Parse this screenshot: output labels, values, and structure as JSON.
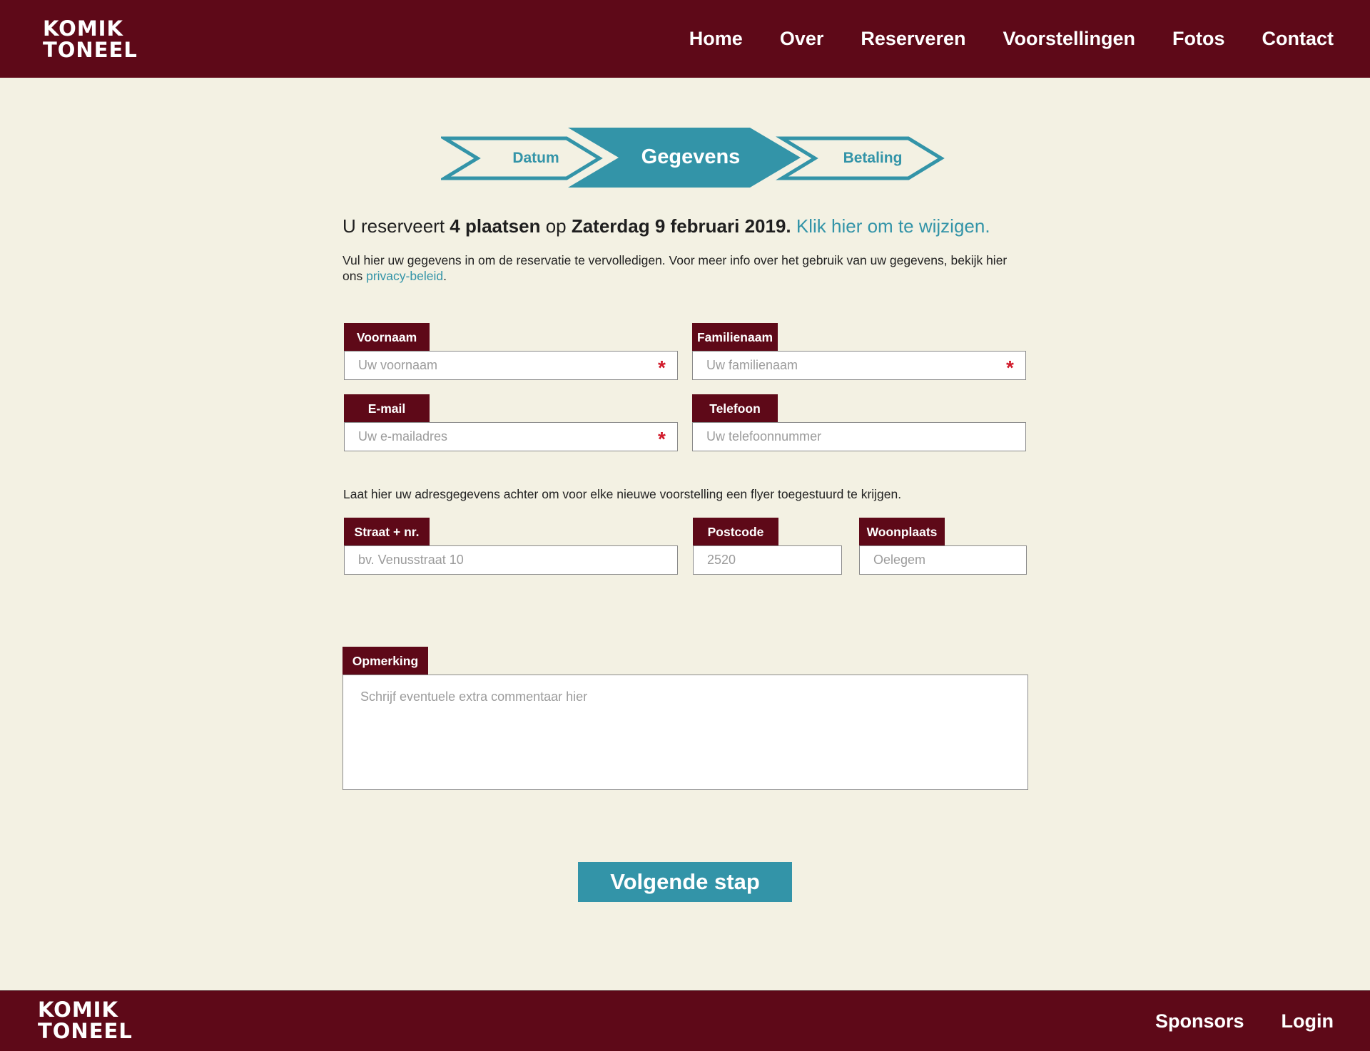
{
  "brand": {
    "logo_line1": "KOMIK",
    "logo_line2": "TONEEL"
  },
  "nav": {
    "items": [
      {
        "label": "Home"
      },
      {
        "label": "Over"
      },
      {
        "label": "Reserveren"
      },
      {
        "label": "Voorstellingen"
      },
      {
        "label": "Fotos"
      },
      {
        "label": "Contact"
      }
    ]
  },
  "stepper": {
    "steps": [
      {
        "label": "Datum",
        "state": "inactive"
      },
      {
        "label": "Gegevens",
        "state": "active"
      },
      {
        "label": "Betaling",
        "state": "inactive"
      }
    ]
  },
  "summary": {
    "prefix": "U reserveert",
    "seats": "4 plaatsen",
    "middle": "op",
    "date": "Zaterdag 9 februari 2019.",
    "change_link": "Klik hier om te wijzigen."
  },
  "info": {
    "text_before": "Vul hier uw gegevens in om de reservatie te vervolledigen. Voor meer info over het gebruik van uw gegevens, bekijk hier ons",
    "privacy_link": "privacy-beleid",
    "text_after": "."
  },
  "fields": {
    "voornaam": {
      "label": "Voornaam",
      "placeholder": "Uw voornaam",
      "required_mark": "*"
    },
    "familienaam": {
      "label": "Familienaam",
      "placeholder": "Uw familienaam",
      "required_mark": "*"
    },
    "email": {
      "label": "E-mail",
      "placeholder": "Uw e-mailadres",
      "required_mark": "*"
    },
    "telefoon": {
      "label": "Telefoon",
      "placeholder": "Uw telefoonnummer"
    },
    "straat": {
      "label": "Straat + nr.",
      "placeholder": "bv. Venusstraat 10"
    },
    "postcode": {
      "label": "Postcode",
      "placeholder": "2520"
    },
    "woonplaats": {
      "label": "Woonplaats",
      "placeholder": "Oelegem"
    }
  },
  "address_info": "Laat hier uw adresgegevens achter om voor elke nieuwe voorstelling een flyer toegestuurd te krijgen.",
  "remark": {
    "label": "Opmerking",
    "placeholder": "Schrijf eventuele extra commentaar hier"
  },
  "next_button": "Volgende stap",
  "footer": {
    "items": [
      {
        "label": "Sponsors"
      },
      {
        "label": "Login"
      }
    ]
  },
  "colors": {
    "header_bg": "#5e0918",
    "page_bg": "#f3f1e3",
    "accent": "#3394a8",
    "required": "#d11a2a"
  }
}
